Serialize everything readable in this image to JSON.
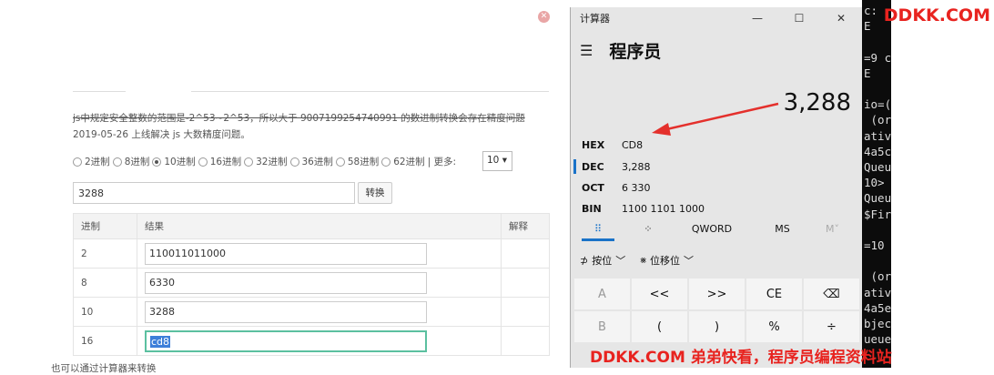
{
  "web": {
    "notice": "js中规定安全整数的范围是-2^53~2^53，所以大于 9007199254740991 的数进制转换会存在精度问题",
    "update": "2019-05-26 上线解决 js 大数精度问题。",
    "radios": [
      {
        "label": "2进制",
        "checked": false
      },
      {
        "label": "8进制",
        "checked": false
      },
      {
        "label": "10进制",
        "checked": true
      },
      {
        "label": "16进制",
        "checked": false
      },
      {
        "label": "32进制",
        "checked": false
      },
      {
        "label": "36进制",
        "checked": false
      },
      {
        "label": "58进制",
        "checked": false
      },
      {
        "label": "62进制",
        "checked": false
      }
    ],
    "more_label": "| 更多:",
    "more_value": "10 ▾",
    "input_value": "3288",
    "convert_label": "转换",
    "table": {
      "headers": [
        "进制",
        "结果",
        "解释"
      ],
      "rows": [
        {
          "base": "2",
          "result": "110011011000"
        },
        {
          "base": "8",
          "result": "6330"
        },
        {
          "base": "10",
          "result": "3288"
        },
        {
          "base": "16",
          "result": "cd8"
        }
      ]
    },
    "bottom_text": "也可以通过计算器来转换"
  },
  "calc": {
    "title": "计算器",
    "mode": "程序员",
    "display": "3,288",
    "radix": [
      {
        "key": "HEX",
        "value": "CD8"
      },
      {
        "key": "DEC",
        "value": "3,288"
      },
      {
        "key": "OCT",
        "value": "6 330"
      },
      {
        "key": "BIN",
        "value": "1100 1101 1000"
      }
    ],
    "tabs": [
      "⠿",
      "⁘",
      "QWORD",
      "MS",
      "M˅"
    ],
    "bitops": [
      "按位",
      "﹀",
      "位移位",
      "﹀"
    ],
    "keys": [
      "A",
      "<<",
      ">>",
      "CE",
      "⌫",
      "B",
      "(",
      ")",
      "%",
      "÷"
    ],
    "controls": [
      "—",
      "☐",
      "✕"
    ]
  },
  "terminal": {
    "lines": [
      "c:",
      "E",
      "",
      "=9 c",
      "E",
      "",
      "io=(",
      " (or",
      "ativ",
      "4a5c",
      "Queu",
      "10>",
      "Queu",
      "$Fir",
      "",
      "=10",
      "",
      " (or",
      "ativ",
      "4a5e",
      "bjec",
      "ueue"
    ]
  },
  "watermarks": {
    "top": "DDKK.COM",
    "bottom": "DDKK.COM 弟弟快看，程序员编程资料站"
  },
  "colors": {
    "accent_blue": "#1a73c8",
    "watermark_red": "#e8231f",
    "arrow_red": "#e4302c"
  }
}
